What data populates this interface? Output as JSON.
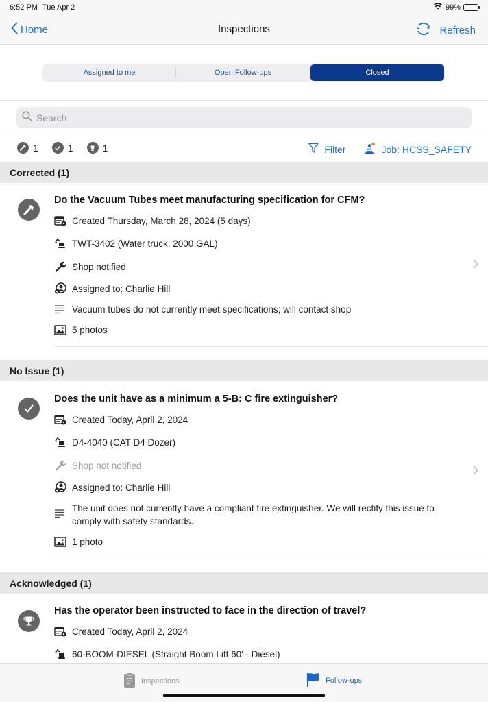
{
  "status_bar": {
    "time": "6:52 PM",
    "date": "Tue Apr 2",
    "battery": "99%"
  },
  "nav": {
    "back_label": "Home",
    "title": "Inspections",
    "refresh_label": "Refresh"
  },
  "segments": [
    {
      "label": "Assigned to me",
      "active": false
    },
    {
      "label": "Open Follow-ups",
      "active": false
    },
    {
      "label": "Closed",
      "active": true
    }
  ],
  "search": {
    "placeholder": "Search",
    "value": ""
  },
  "summary": {
    "counts": [
      {
        "icon": "hammer-icon",
        "value": "1"
      },
      {
        "icon": "check-icon",
        "value": "1"
      },
      {
        "icon": "trophy-icon",
        "value": "1"
      }
    ],
    "filter_label": "Filter",
    "job_label": "Job: HCSS_SAFETY"
  },
  "sections": [
    {
      "header": "Corrected (1)",
      "items": [
        {
          "status_icon": "hammer-icon",
          "title": "Do the Vacuum Tubes meet manufacturing specification for CFM?",
          "created": "Created Thursday, March 28, 2024 (5 days)",
          "equipment": "TWT-3402 (Water truck, 2000 GAL)",
          "shop": "Shop notified",
          "shop_notified": true,
          "assigned": "Assigned to:  Charlie Hill",
          "notes": "Vacuum tubes do not currently meet specifications; will contact shop",
          "photos": "5 photos"
        }
      ]
    },
    {
      "header": "No Issue (1)",
      "items": [
        {
          "status_icon": "check-icon",
          "title": "Does the unit have as a minimum a 5-B: C fire extinguisher?",
          "created": "Created Today, April 2, 2024",
          "equipment": "D4-4040 (CAT D4 Dozer)",
          "shop": "Shop not notified",
          "shop_notified": false,
          "assigned": "Assigned to:  Charlie Hill",
          "notes": "The unit does not currently have a compliant fire extinguisher. We will rectify this issue to comply with safety standards.",
          "photos": "1 photo"
        }
      ]
    },
    {
      "header": "Acknowledged (1)",
      "items": [
        {
          "status_icon": "trophy-icon",
          "title": "Has the operator been instructed to face in the direction of travel?",
          "created": "Created Today, April 2, 2024",
          "equipment": "60-BOOM-DIESEL (Straight Boom Lift 60' - Diesel)"
        }
      ]
    }
  ],
  "tab_bar": {
    "tabs": [
      {
        "label": "Inspections",
        "icon": "clipboard-icon",
        "active": false
      },
      {
        "label": "Follow-ups",
        "icon": "flag-icon",
        "active": true
      }
    ]
  },
  "colors": {
    "accent": "#1a73d1",
    "segment_active": "#0b3a8c",
    "status_icon_bg": "#646464",
    "section_header_bg": "#e8e8e8",
    "job_dot": "#f07a22"
  }
}
